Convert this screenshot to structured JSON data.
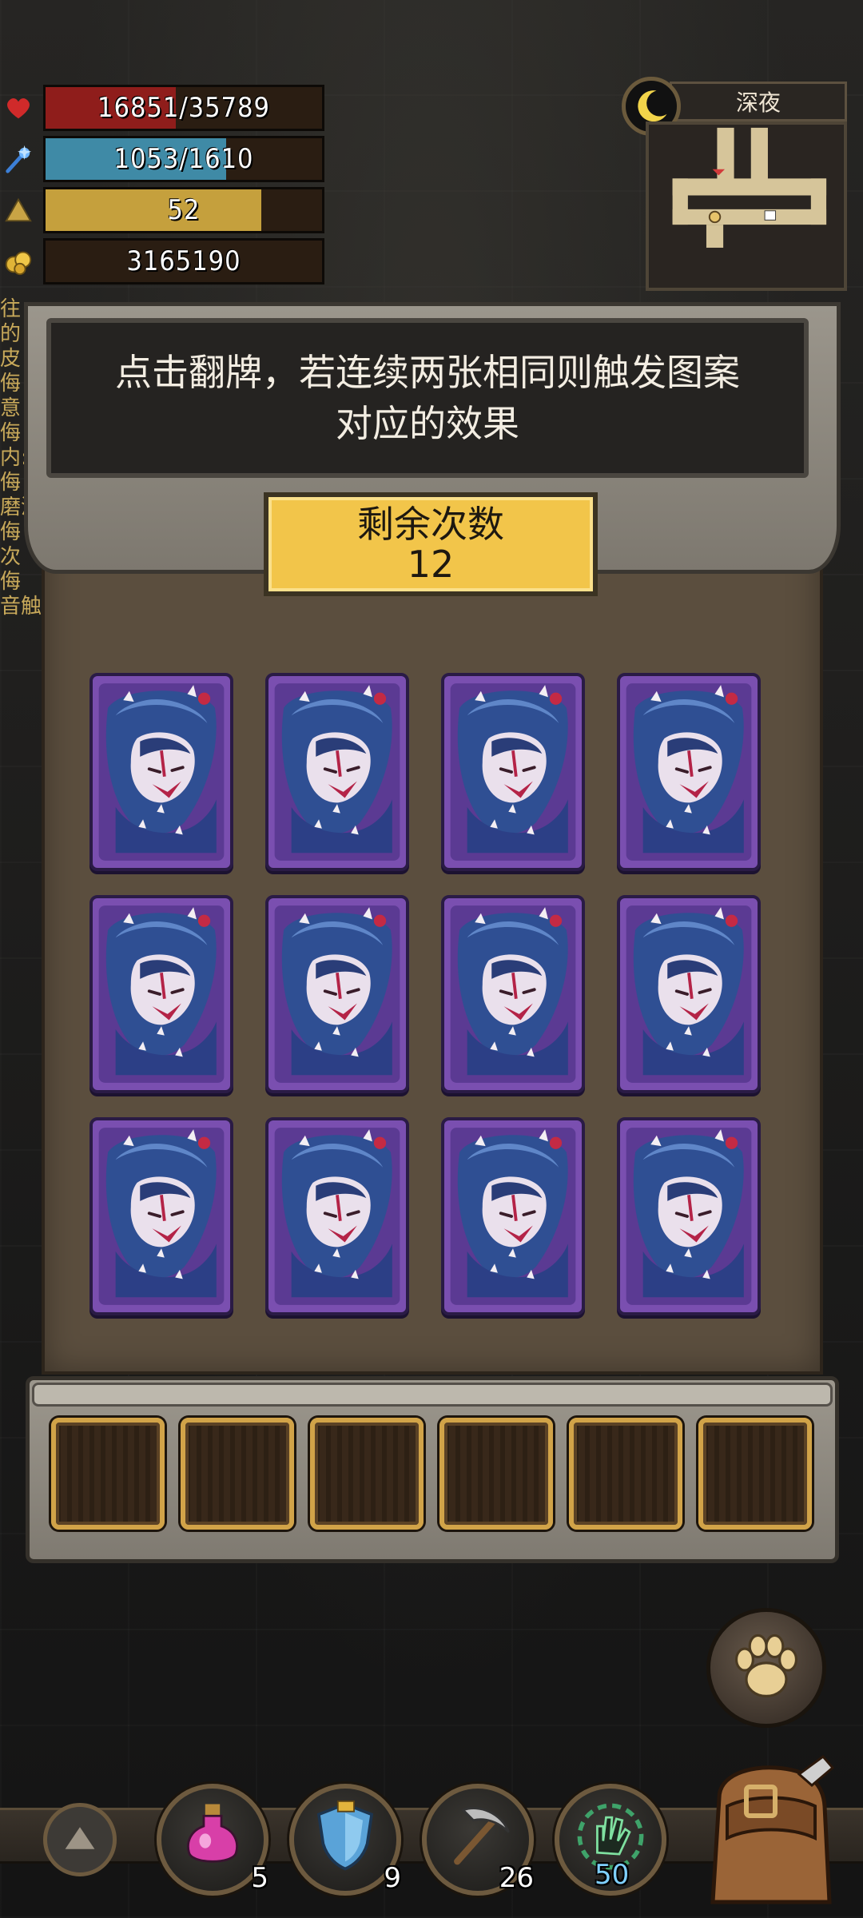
{
  "stats": {
    "hp": {
      "text": "16851/35789",
      "fraction": 0.471,
      "color": "#8f1d1b",
      "icon": "heart-icon"
    },
    "mp": {
      "text": "1053/1610",
      "fraction": 0.654,
      "color": "#3f8aa6",
      "icon": "mana-icon"
    },
    "level": {
      "text": "52",
      "fraction": 0.78,
      "color": "#c5a03d",
      "icon": "level-triangle-icon"
    },
    "gold": {
      "text": "3165190",
      "fraction": 0,
      "color": "#2a1d12",
      "icon": "gold-icon"
    }
  },
  "time": {
    "label": "深夜",
    "icon": "moon-icon"
  },
  "side_list": [
    "往",
    "的",
    "皮",
    "侮",
    "意",
    "侮",
    "内:",
    "侮",
    "磨洞",
    "侮",
    "次",
    "侮",
    "音触"
  ],
  "instructions": "点击翻牌，若连续两张相同则触发图案对应的效果",
  "remaining": {
    "label": "剩余次数",
    "value": "12"
  },
  "cards": {
    "count": 12,
    "state": "face-down",
    "art": "hooded-girl-card-back"
  },
  "slots": {
    "count": 6
  },
  "toolbar": {
    "items": [
      {
        "name": "potion",
        "icon": "pink-potion-icon",
        "count": "5"
      },
      {
        "name": "shield",
        "icon": "blue-shield-icon",
        "count": "9"
      },
      {
        "name": "pickaxe",
        "icon": "pickaxe-icon",
        "count": "26"
      },
      {
        "name": "glove",
        "icon": "green-hand-icon",
        "count": "50"
      }
    ],
    "up_icon": "up-arrow-icon",
    "paw_icon": "paw-icon",
    "bag_icon": "backpack-icon"
  }
}
